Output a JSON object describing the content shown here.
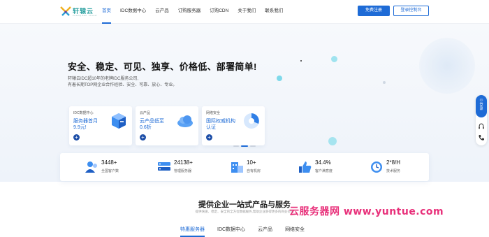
{
  "brand": {
    "logo_text": "轩辕云",
    "logo_sub": "xuanyuan cloud"
  },
  "nav": {
    "items": [
      {
        "label": "首页",
        "active": true
      },
      {
        "label": "IDC数据中心",
        "active": false
      },
      {
        "label": "云产品",
        "active": false
      },
      {
        "label": "订购服务器",
        "active": false
      },
      {
        "label": "订购CDN",
        "active": false
      },
      {
        "label": "关于我们",
        "active": false
      },
      {
        "label": "联系我们",
        "active": false
      }
    ],
    "register_label": "免费注册",
    "console_label": "登录控制台"
  },
  "hero": {
    "title": "安全、稳定、可见、独享、价格低、部署简单!",
    "subtitle_1": "轩辕云IDC超10年的老牌IDC服务公司,",
    "subtitle_2": "有着长期TOP网企业合作经验、安全、可靠、放心、专业。"
  },
  "feature_cards": [
    {
      "tag": "IDC数据中心",
      "line1": "服务器首月",
      "line2": "9.9元!",
      "icon": "server-cube-icon"
    },
    {
      "tag": "云产品",
      "line1": "云产品低至",
      "line2": "0.6折",
      "icon": "cloud-icon"
    },
    {
      "tag": "网络安全",
      "line1": "国际权威机构",
      "line2": "认证",
      "icon": "pie-shield-icon"
    }
  ],
  "carousel": {
    "active_index": 1,
    "count": 3
  },
  "stats": [
    {
      "number": "3448+",
      "label": "全国客户数",
      "icon": "users-icon"
    },
    {
      "number": "24138+",
      "label": "管理服务器",
      "icon": "server-rack-icon"
    },
    {
      "number": "10+",
      "label": "自有机房",
      "icon": "building-icon"
    },
    {
      "number": "34.4%",
      "label": "客户满意度",
      "icon": "thumbs-up-icon"
    },
    {
      "number": "2*8/H",
      "label": "技术服务",
      "icon": "clock-icon"
    }
  ],
  "section": {
    "title": "提供企业一站式产品与服务",
    "subtitle": "提供快速、稳定、安全的全方位数据服务,帮助企业获得更多的商业价值"
  },
  "tabs": [
    {
      "label": "特惠服务器",
      "active": true
    },
    {
      "label": "IDC数据中心",
      "active": false
    },
    {
      "label": "云产品",
      "active": false
    },
    {
      "label": "网络安全",
      "active": false
    }
  ],
  "watermark": "云服务器网 www.yuntue.com",
  "float_bar": {
    "top_label_1": "登",
    "top_label_2": "录"
  },
  "colors": {
    "accent": "#1e6bd6",
    "hero_bg": "#f2f6fb",
    "watermark": "#e8307a"
  }
}
